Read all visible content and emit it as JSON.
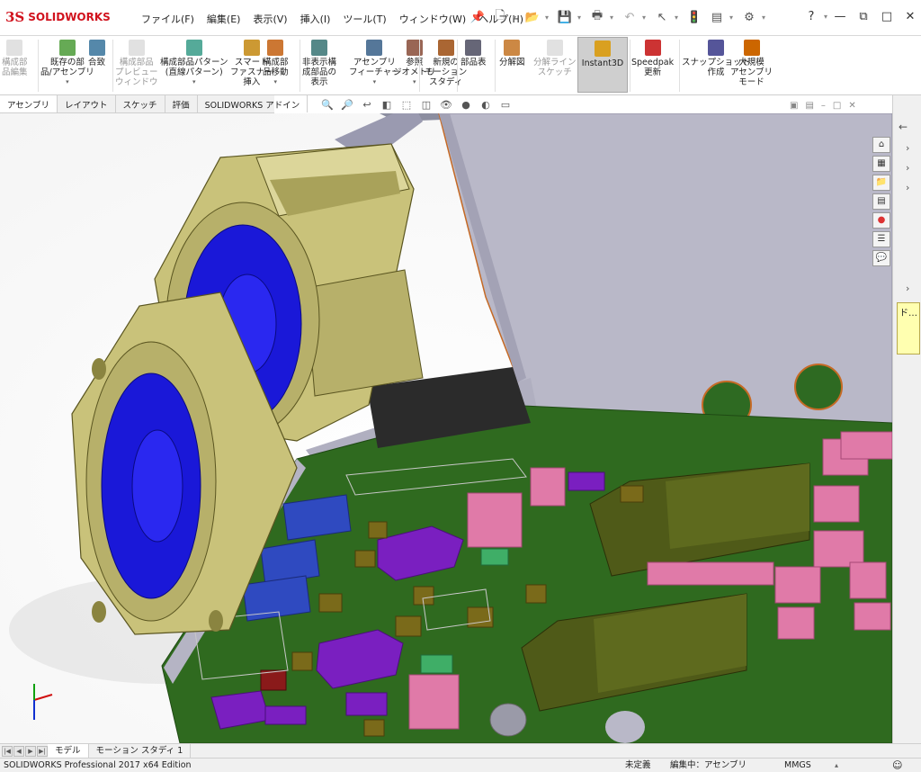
{
  "app": {
    "logo_ds": "3S",
    "logo_name": "SOLIDWORKS"
  },
  "menu": [
    "ファイル(F)",
    "編集(E)",
    "表示(V)",
    "挿入(I)",
    "ツール(T)",
    "ウィンドウ(W)",
    "ヘルプ(H)"
  ],
  "window_controls": {
    "help": "?",
    "minimize": "—",
    "restore": "⧉",
    "close": "✕"
  },
  "ribbon": [
    {
      "label": "構成部\n品編集",
      "icon": "edit-component-icon",
      "disabled": true
    },
    {
      "label": "既存の部\n品/アセンブリ",
      "icon": "insert-component-icon",
      "dropdown": true
    },
    {
      "label": "合致",
      "icon": "mate-icon"
    },
    {
      "label": "構成部品\nプレビュー\nウィンドウ",
      "icon": "component-preview-icon",
      "disabled": true
    },
    {
      "label": "構成部品パターン\n(直線パターン)",
      "icon": "linear-pattern-icon",
      "dropdown": true
    },
    {
      "label": "スマート\nファスナー\n挿入",
      "icon": "smart-fastener-icon"
    },
    {
      "label": "構成部\n品移動",
      "icon": "move-component-icon",
      "dropdown": true
    },
    {
      "label": "非表示構\n成部品の\n表示",
      "icon": "show-hidden-icon"
    },
    {
      "label": "アセンブリ\nフィーチャー",
      "icon": "assembly-feature-icon",
      "dropdown": true
    },
    {
      "label": "参照\nジオメトリ",
      "icon": "reference-geometry-icon",
      "dropdown": true
    },
    {
      "label": "新規の\nモーション\nスタディ",
      "icon": "motion-study-icon"
    },
    {
      "label": "部品表",
      "icon": "bom-icon"
    },
    {
      "label": "分解図",
      "icon": "exploded-view-icon"
    },
    {
      "label": "分解ライン\nスケッチ",
      "icon": "explode-line-icon",
      "disabled": true
    },
    {
      "label": "Instant3D",
      "icon": "instant3d-icon",
      "active": true
    },
    {
      "label": "Speedpak\n更新",
      "icon": "speedpak-icon"
    },
    {
      "label": "スナップショット\n作成",
      "icon": "snapshot-icon"
    },
    {
      "label": "大規模\nアセンブリ\nモード",
      "icon": "large-assembly-icon"
    }
  ],
  "cmd_tabs": [
    "アセンブリ",
    "レイアウト",
    "スケッチ",
    "評価",
    "SOLIDWORKS アドイン"
  ],
  "bottom_tabs": [
    "モデル",
    "モーション スタディ 1"
  ],
  "status": {
    "edition": "SOLIDWORKS Professional 2017 x64 Edition",
    "state": "未定義",
    "editing": "編集中：アセンブリ",
    "units": "MMGS"
  },
  "right_note": "ド…",
  "colors": {
    "brand": "#d1121d",
    "fan_housing": "#c9c27a",
    "fan_blade": "#1a18d8",
    "pcb": "#2f6a1f",
    "sheet_metal": "#b9b8c8"
  }
}
